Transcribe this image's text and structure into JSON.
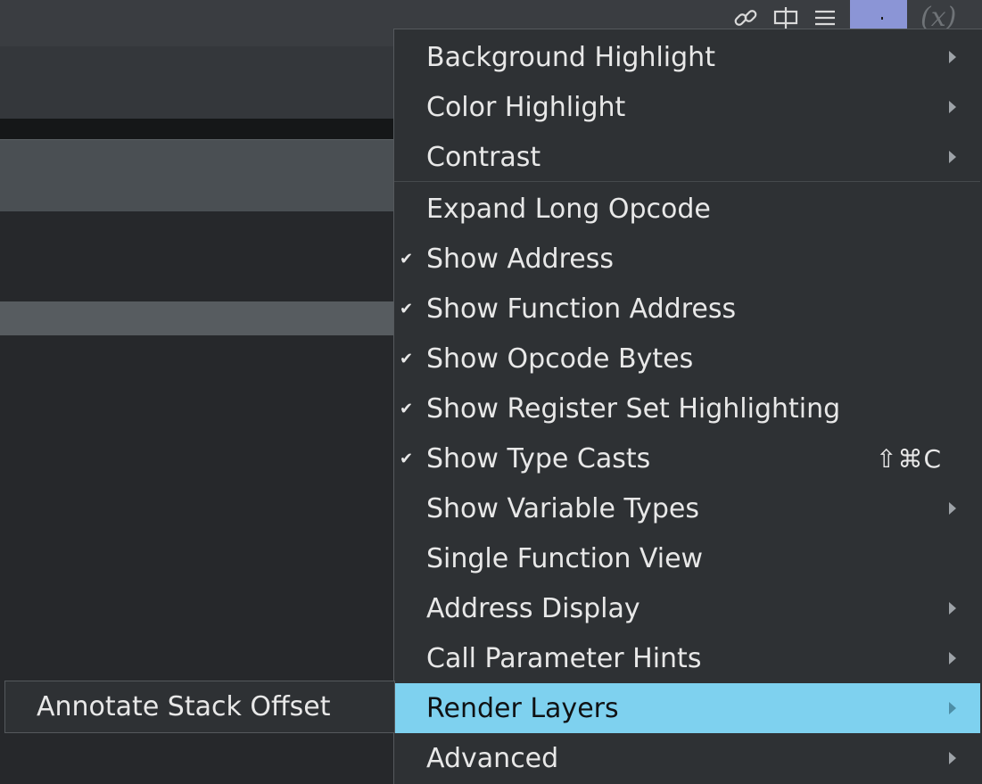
{
  "toolbar": {
    "icons": [
      "link-icon",
      "split-view-icon",
      "hamburger-menu-icon",
      "variables-icon"
    ],
    "variables_glyph": "(x)"
  },
  "menu": {
    "items": [
      {
        "label": "Background Highlight",
        "checked": false,
        "submenu": true
      },
      {
        "label": "Color Highlight",
        "checked": false,
        "submenu": true
      },
      {
        "label": "Contrast",
        "checked": false,
        "submenu": true
      },
      {
        "label": "Expand Long Opcode",
        "checked": false,
        "submenu": false
      },
      {
        "label": "Show Address",
        "checked": true,
        "submenu": false
      },
      {
        "label": "Show Function Address",
        "checked": true,
        "submenu": false
      },
      {
        "label": "Show Opcode Bytes",
        "checked": true,
        "submenu": false
      },
      {
        "label": "Show Register Set Highlighting",
        "checked": true,
        "submenu": false
      },
      {
        "label": "Show Type Casts",
        "checked": true,
        "submenu": false,
        "shortcut": "⇧⌘C"
      },
      {
        "label": "Show Variable Types",
        "checked": false,
        "submenu": true
      },
      {
        "label": "Single Function View",
        "checked": false,
        "submenu": false
      },
      {
        "label": "Address Display",
        "checked": false,
        "submenu": true
      },
      {
        "label": "Call Parameter Hints",
        "checked": false,
        "submenu": true
      },
      {
        "label": "Render Layers",
        "checked": false,
        "submenu": true,
        "highlighted": true
      },
      {
        "label": "Advanced",
        "checked": false,
        "submenu": true
      }
    ],
    "check_glyph": "✔"
  },
  "submenu": {
    "items": [
      {
        "label": "Annotate Stack Offset"
      }
    ]
  },
  "colors": {
    "highlight": "#7ed1ef",
    "menu_bg": "#2e3134",
    "selected_toolbar_button": "#8b95d6"
  }
}
